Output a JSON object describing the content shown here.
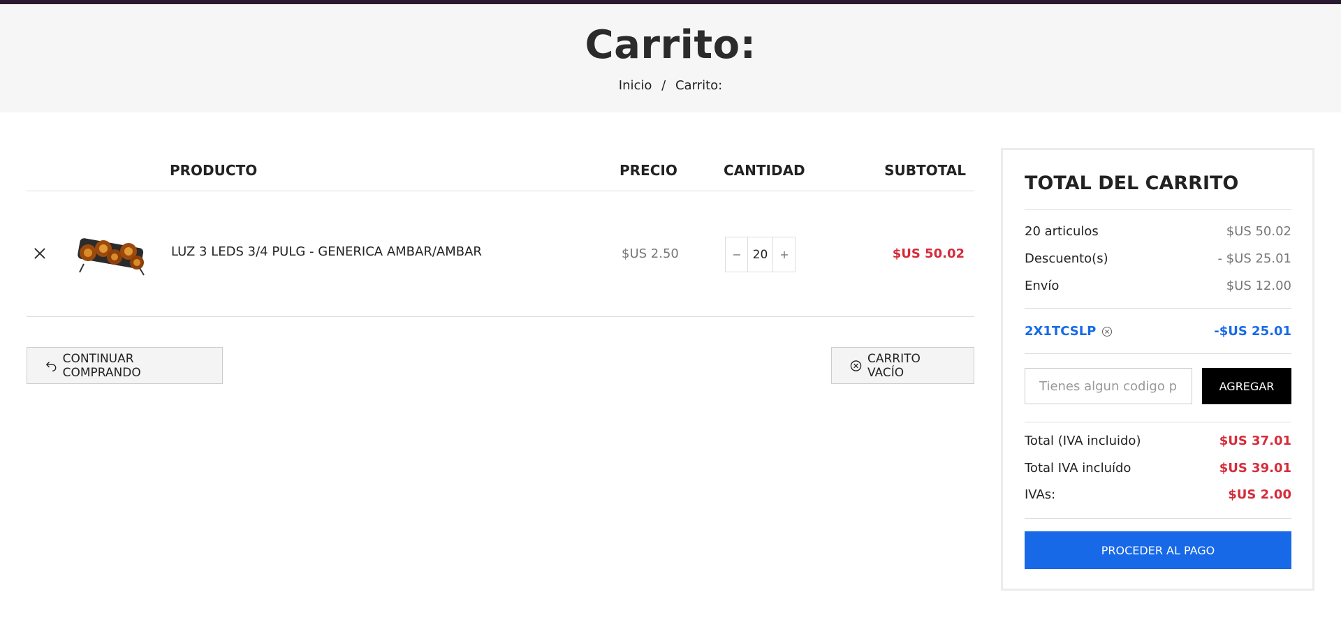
{
  "header": {
    "title": "Carrito:",
    "breadcrumb": {
      "home": "Inicio",
      "separator": "/",
      "current": "Carrito:"
    }
  },
  "cart": {
    "columns": {
      "product": "PRODUCTO",
      "price": "PRECIO",
      "quantity": "CANTIDAD",
      "subtotal": "SUBTOTAL"
    },
    "items": [
      {
        "name": "LUZ 3 LEDS 3/4 PULG - GENERICA AMBAR/AMBAR",
        "price": "$US 2.50",
        "quantity": "20",
        "subtotal": "$US 50.02"
      }
    ],
    "continue_label": "CONTINUAR COMPRANDO",
    "empty_label": "CARRITO VACÍO"
  },
  "totals": {
    "title": "TOTAL DEL CARRITO",
    "items_label": "20 articulos",
    "items_value": "$US 50.02",
    "discount_label": "Descuento(s)",
    "discount_value": "- $US 25.01",
    "shipping_label": "Envío",
    "shipping_value": "$US 12.00",
    "coupon_code": "2X1TCSLP",
    "coupon_value": "-$US 25.01",
    "promo_placeholder": "Tienes algun codigo promocional?",
    "add_label": "AGREGAR",
    "total_label": "Total (IVA incluido)",
    "total_value": "$US 37.01",
    "total_vat_label": "Total IVA incluído",
    "total_vat_value": "$US 39.01",
    "vat_label": "IVAs:",
    "vat_value": "$US 2.00",
    "checkout_label": "PROCEDER AL PAGO"
  },
  "colors": {
    "accent": "#1769e8",
    "price_red": "#d62b3a",
    "dark": "#222222"
  }
}
